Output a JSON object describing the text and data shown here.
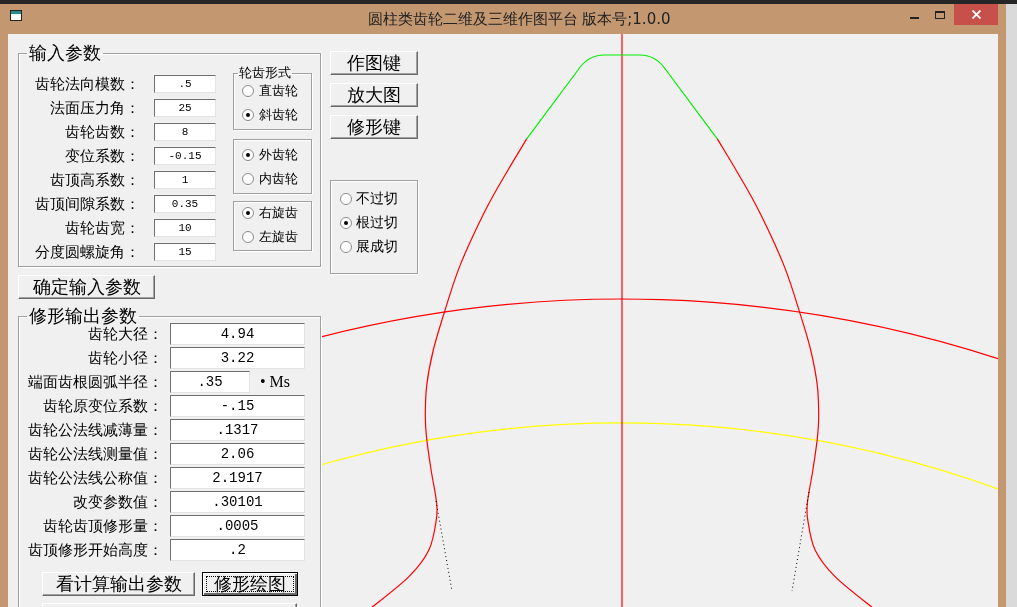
{
  "window": {
    "title": "圆柱类齿轮二维及三维作图平台 版本号;1.0.0"
  },
  "input_group": {
    "title": "输入参数",
    "fields": [
      {
        "label": "齿轮法向模数：",
        "value": ".5"
      },
      {
        "label": "法面压力角：",
        "value": "25"
      },
      {
        "label": "齿轮齿数：",
        "value": "8"
      },
      {
        "label": "变位系数：",
        "value": "-0.15"
      },
      {
        "label": "齿顶高系数：",
        "value": "1"
      },
      {
        "label": "齿顶间隙系数：",
        "value": "0.35"
      },
      {
        "label": "齿轮齿宽：",
        "value": "10"
      },
      {
        "label": "分度圆螺旋角：",
        "value": "15"
      }
    ],
    "radio_groups": [
      {
        "title": "轮齿形式",
        "options": [
          {
            "label": "直齿轮",
            "selected": false
          },
          {
            "label": "斜齿轮",
            "selected": true
          }
        ]
      },
      {
        "options": [
          {
            "label": "外齿轮",
            "selected": true
          },
          {
            "label": "内齿轮",
            "selected": false
          }
        ]
      },
      {
        "options": [
          {
            "label": "右旋齿",
            "selected": true
          },
          {
            "label": "左旋齿",
            "selected": false
          }
        ]
      }
    ]
  },
  "confirm_button": {
    "label": "确定输入参数"
  },
  "output_group": {
    "title": "修形输出参数",
    "fields": [
      {
        "label": "齿轮大径：",
        "value": "4.94"
      },
      {
        "label": "齿轮小径：",
        "value": "3.22"
      },
      {
        "label": "端面齿根圆弧半径：",
        "value": ".35",
        "unit": "• Ms"
      },
      {
        "label": "齿轮原变位系数：",
        "value": "-.15"
      },
      {
        "label": "齿轮公法线减薄量：",
        "value": ".1317"
      },
      {
        "label": "齿轮公法线测量值：",
        "value": "2.06"
      },
      {
        "label": "齿轮公法线公称值：",
        "value": "2.1917"
      },
      {
        "label": "改变参数值：",
        "value": ".30101"
      },
      {
        "label": "齿轮齿顶修形量：",
        "value": ".0005"
      },
      {
        "label": "齿顶修形开始高度：",
        "value": ".2"
      }
    ],
    "buttons": [
      {
        "label": "看计算输出参数",
        "focused": false
      },
      {
        "label": "修形绘图",
        "focused": true
      }
    ]
  },
  "tool_buttons": [
    {
      "label": "作图键"
    },
    {
      "label": "放大图"
    },
    {
      "label": "修形键"
    }
  ],
  "undercut_group": {
    "options": [
      {
        "label": "不过切",
        "selected": false
      },
      {
        "label": "根过切",
        "selected": true
      },
      {
        "label": "展成切",
        "selected": false
      }
    ]
  }
}
